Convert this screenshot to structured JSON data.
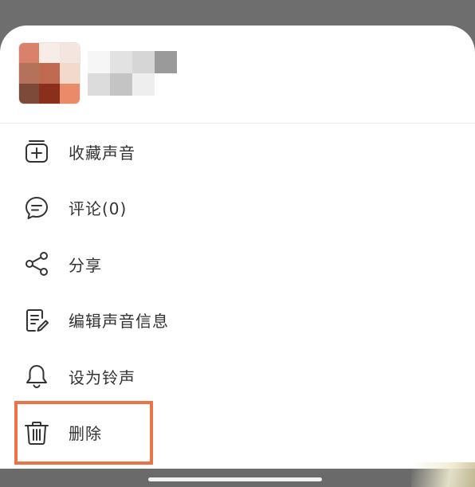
{
  "menu": {
    "items": [
      {
        "label": "收藏声音",
        "icon": "add-favorite-icon"
      },
      {
        "label": "评论(0)",
        "icon": "comment-icon"
      },
      {
        "label": "分享",
        "icon": "share-icon"
      },
      {
        "label": "编辑声音信息",
        "icon": "edit-info-icon"
      },
      {
        "label": "设为铃声",
        "icon": "bell-icon"
      },
      {
        "label": "删除",
        "icon": "trash-icon"
      }
    ]
  },
  "colors": {
    "highlight_border": "#ec7347",
    "text": "#333333",
    "icon": "#333333",
    "backdrop": "#6e6e6e"
  }
}
